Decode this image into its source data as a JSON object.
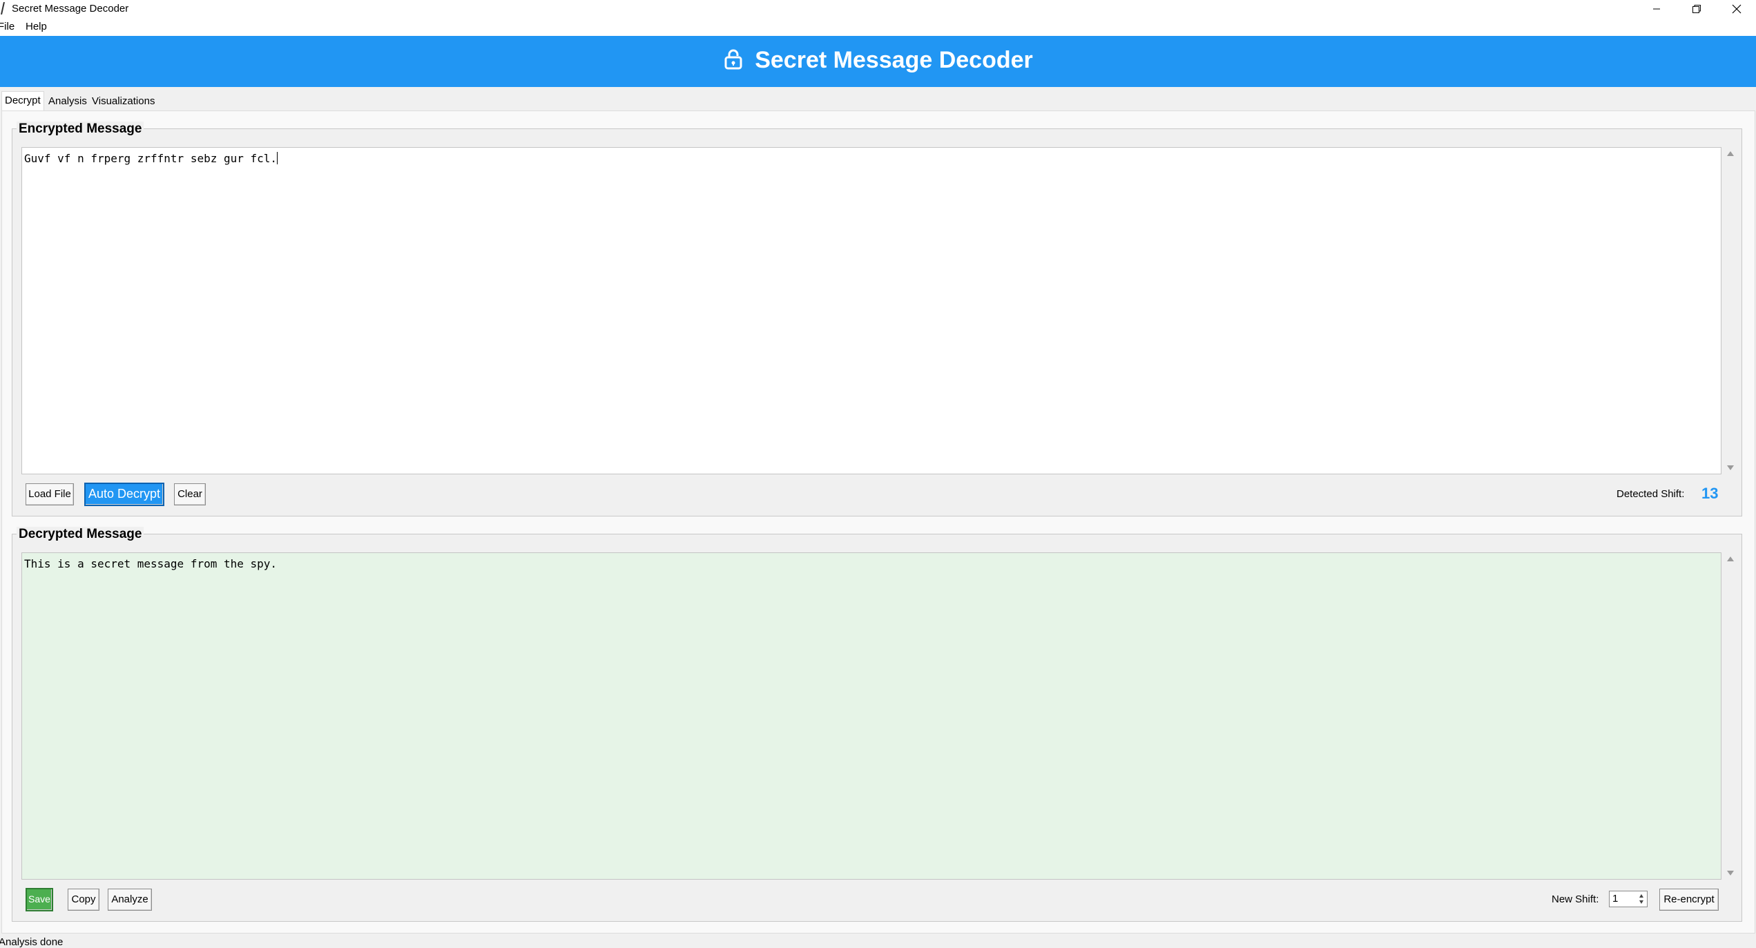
{
  "window": {
    "title": "Secret Message Decoder",
    "minimize": "minimize-icon",
    "maximize": "restore-icon",
    "close": "close-icon"
  },
  "menu": {
    "items": [
      "File",
      "Help"
    ]
  },
  "header": {
    "title": "Secret Message Decoder",
    "icon": "lock-icon",
    "color": "#2196F3"
  },
  "tabs": [
    "Decrypt",
    "Analysis",
    "Visualizations"
  ],
  "encrypted": {
    "label": "Encrypted Message",
    "text": "Guvf vf n frperg zrffntr sebz gur fcl.",
    "buttons": {
      "load": "Load File",
      "auto": "Auto Decrypt",
      "clear": "Clear"
    },
    "shift_label": "Detected Shift:",
    "shift_value": "13"
  },
  "decrypted": {
    "label": "Decrypted Message",
    "text": "This is a secret message from the spy.",
    "buttons": {
      "save": "Save",
      "copy": "Copy",
      "analyze": "Analyze",
      "reencrypt": "Re-encrypt"
    },
    "new_shift_label": "New Shift:",
    "new_shift_value": "1"
  },
  "status": "Analysis done"
}
